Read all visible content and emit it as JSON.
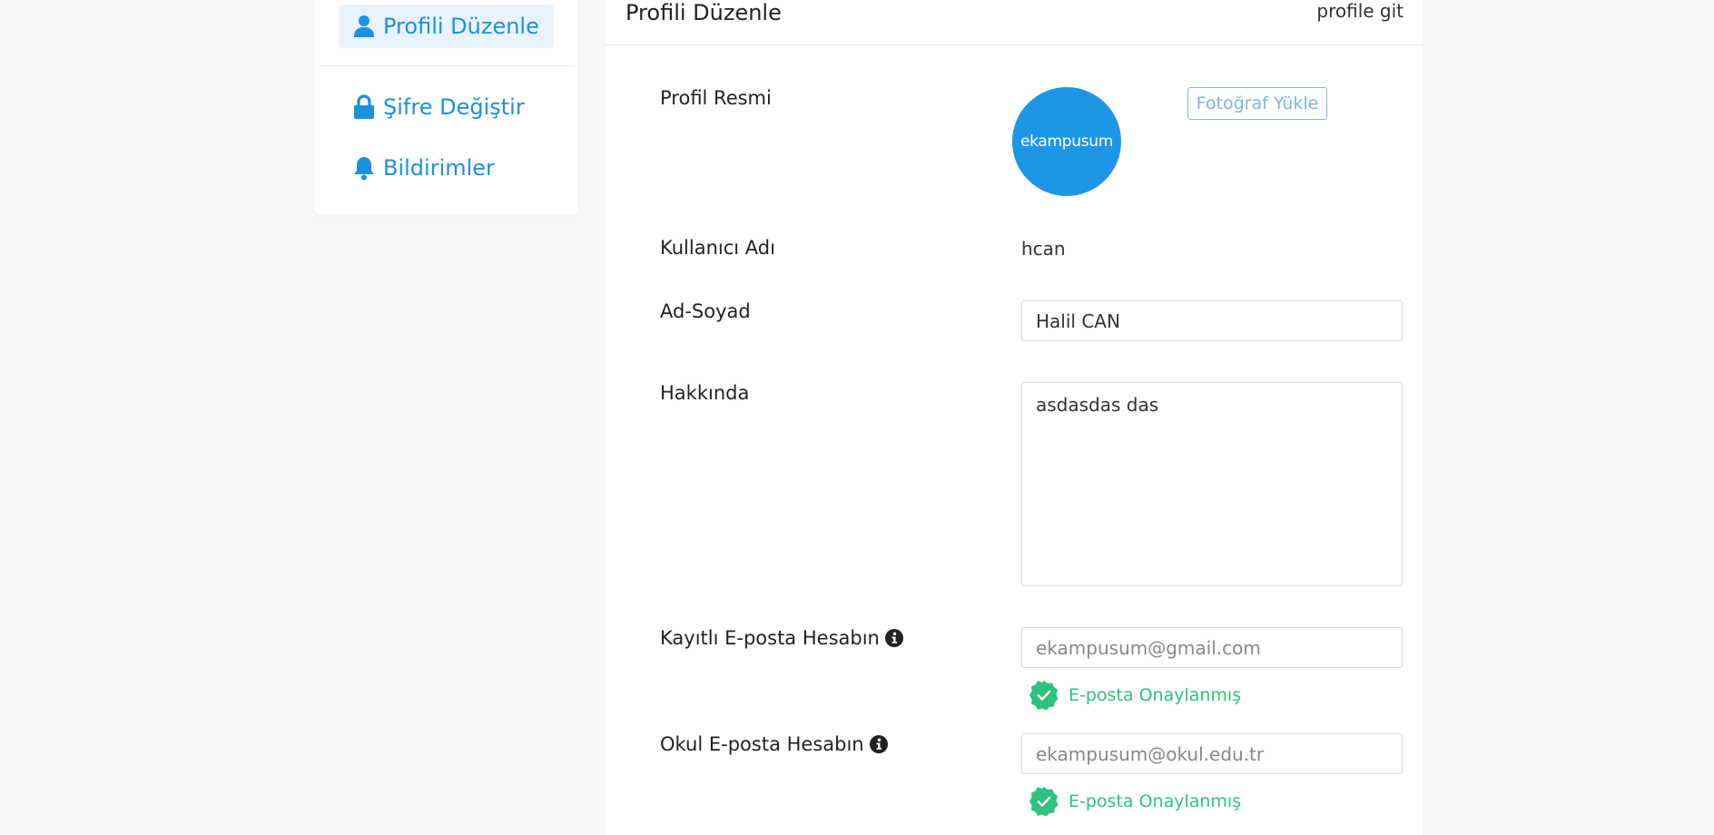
{
  "sidebar": {
    "items": [
      {
        "label": "Profili Düzenle",
        "icon": "user-icon",
        "active": true
      },
      {
        "label": "Şifre Değiştir",
        "icon": "lock-icon",
        "active": false
      },
      {
        "label": "Bildirimler",
        "icon": "bell-icon",
        "active": false
      }
    ]
  },
  "header": {
    "title": "Profili Düzenle",
    "profile_link": "profile git"
  },
  "form": {
    "profile_picture": {
      "label": "Profil Resmi",
      "avatar_text": "ekampusum",
      "upload_button": "Fotoğraf Yükle"
    },
    "username": {
      "label": "Kullanıcı Adı",
      "value": "hcan"
    },
    "full_name": {
      "label": "Ad-Soyad",
      "value": "Halil CAN"
    },
    "about": {
      "label": "Hakkında",
      "value": "asdasdas das"
    },
    "registered_email": {
      "label": "Kayıtlı E-posta Hesabın",
      "placeholder": "ekampusum@gmail.com",
      "status": "E-posta Onaylanmış"
    },
    "school_email": {
      "label": "Okul E-posta Hesabın",
      "placeholder": "ekampusum@okul.edu.tr",
      "status": "E-posta Onaylanmış"
    }
  },
  "colors": {
    "accent": "#1e90e0",
    "active_bg": "#e8f3fd",
    "verified": "#2ec27e",
    "page_bg": "#f7f7f7"
  }
}
